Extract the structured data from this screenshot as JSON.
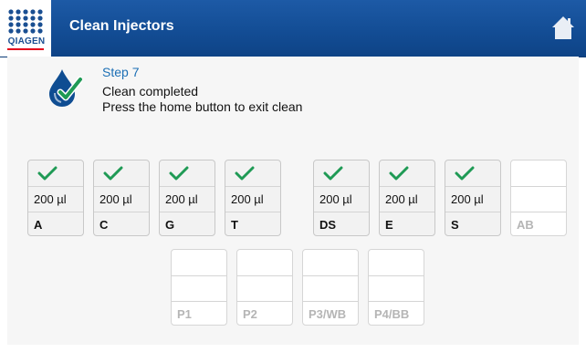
{
  "header": {
    "logo_text": "QIAGEN",
    "title": "Clean Injectors",
    "home_icon": "home-icon"
  },
  "status": {
    "icon": "water-drop-check-icon",
    "step": "Step 7",
    "line1": "Clean completed",
    "line2": "Press the home button to exit clean"
  },
  "reagents": [
    {
      "name": "A",
      "volume": "200 µl",
      "done": true
    },
    {
      "name": "C",
      "volume": "200 µl",
      "done": true
    },
    {
      "name": "G",
      "volume": "200 µl",
      "done": true
    },
    {
      "name": "T",
      "volume": "200 µl",
      "done": true
    },
    {
      "name": "DS",
      "volume": "200 µl",
      "done": true
    },
    {
      "name": "E",
      "volume": "200 µl",
      "done": true
    },
    {
      "name": "S",
      "volume": "200 µl",
      "done": true
    },
    {
      "name": "AB",
      "volume": "",
      "done": false
    }
  ],
  "ports": [
    {
      "name": "P1",
      "volume": "",
      "done": false
    },
    {
      "name": "P2",
      "volume": "",
      "done": false
    },
    {
      "name": "P3/WB",
      "volume": "",
      "done": false
    },
    {
      "name": "P4/BB",
      "volume": "",
      "done": false
    }
  ],
  "colors": {
    "header_blue": "#134d95",
    "accent_blue": "#1c6fb5",
    "check_green": "#1f9a55",
    "logo_red": "#e3001b"
  }
}
